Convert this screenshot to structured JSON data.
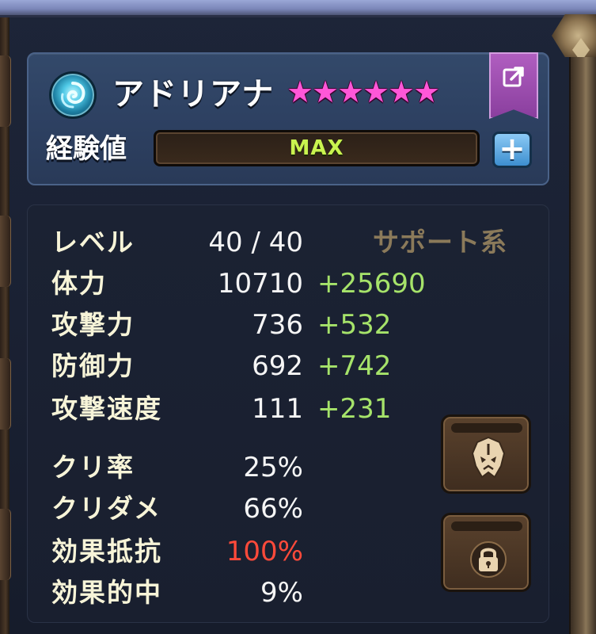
{
  "character": {
    "name": "アドリアナ",
    "stars": [
      "★",
      "★",
      "★",
      "★",
      "★",
      "★"
    ],
    "element_icon": "wind-swirl-icon"
  },
  "exp": {
    "label": "経験値",
    "value": "MAX",
    "plus_label": "+"
  },
  "role": "サポート系",
  "stats": [
    {
      "label": "レベル",
      "value": "40 / 40",
      "bonus": ""
    },
    {
      "label": "体力",
      "value": "10710",
      "bonus": "+25690"
    },
    {
      "label": "攻撃力",
      "value": "736",
      "bonus": "+532"
    },
    {
      "label": "防御力",
      "value": "692",
      "bonus": "+742"
    },
    {
      "label": "攻撃速度",
      "value": "111",
      "bonus": "+231"
    },
    {
      "label": "クリ率",
      "value": "25%",
      "bonus": ""
    },
    {
      "label": "クリダメ",
      "value": "66%",
      "bonus": ""
    },
    {
      "label": "効果抵抗",
      "value": "100%",
      "bonus": "",
      "highlight": "#ff4a3a"
    },
    {
      "label": "効果的中",
      "value": "9%",
      "bonus": ""
    }
  ],
  "icons": {
    "share": "share-icon",
    "rune": "rune-mask-icon",
    "lock": "lock-icon"
  },
  "colors": {
    "bonus": "#a6e36a",
    "max": "#c9f34f",
    "star": "#ff57d8",
    "role": "#8b7a5a"
  }
}
